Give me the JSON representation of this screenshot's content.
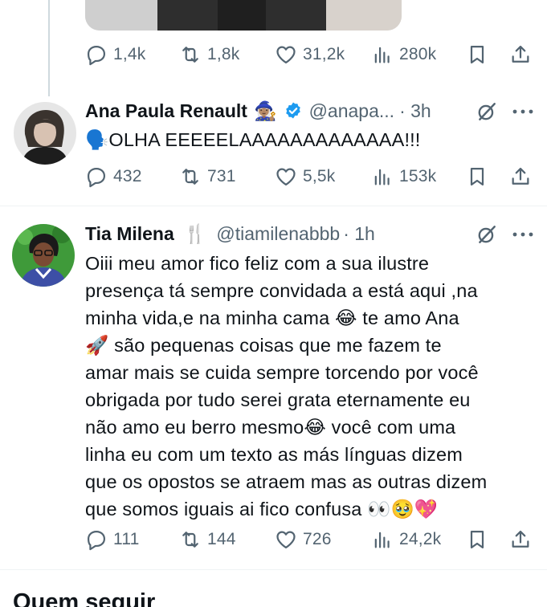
{
  "tweets": [
    {
      "stats": {
        "replies": "1,4k",
        "retweets": "1,8k",
        "likes": "31,2k",
        "views": "280k"
      }
    },
    {
      "name": "Ana Paula Renault",
      "name_badge": "🧙🏽‍♀️",
      "verified": true,
      "handle": "@anapa...",
      "time": "· 3h",
      "text_lines": [
        "🗣️OLHA EEEEELAAAAAAAAAAAAA!!!"
      ],
      "stats": {
        "replies": "432",
        "retweets": "731",
        "likes": "5,5k",
        "views": "153k"
      }
    },
    {
      "name": "Tia Milena",
      "name_badge": "🍴",
      "verified": false,
      "handle": "@tiamilenabbb",
      "time": "· 1h",
      "text_lines": [
        "Oiii meu amor fico feliz com a sua ilustre",
        "presença tá sempre convidada a está aqui ,na",
        "minha vida,e na minha cama 😂 te amo Ana",
        "🚀 são pequenas coisas que me fazem te",
        "amar mais se cuida sempre torcendo por você",
        "obrigada por tudo serei grata eternamente eu",
        "não amo eu berro mesmo😂 você com uma",
        "linha eu com um texto as más línguas dizem",
        "que os opostos se atraem mas as outras dizem",
        "que somos iguais ai fico confusa 👀🥹💖"
      ],
      "stats": {
        "replies": "111",
        "retweets": "144",
        "likes": "726",
        "views": "24,2k"
      }
    }
  ],
  "section_title": "Quem seguir",
  "icons": {
    "reply": "reply-icon",
    "retweet": "retweet-icon",
    "like": "heart-icon",
    "views": "views-icon",
    "bookmark": "bookmark-icon",
    "share": "share-icon",
    "grok": "grok-icon",
    "more": "more-icon",
    "verified": "verified-badge-icon"
  },
  "colors": {
    "muted": "#536471",
    "verified": "#1d9bf0",
    "text": "#0f1419"
  }
}
